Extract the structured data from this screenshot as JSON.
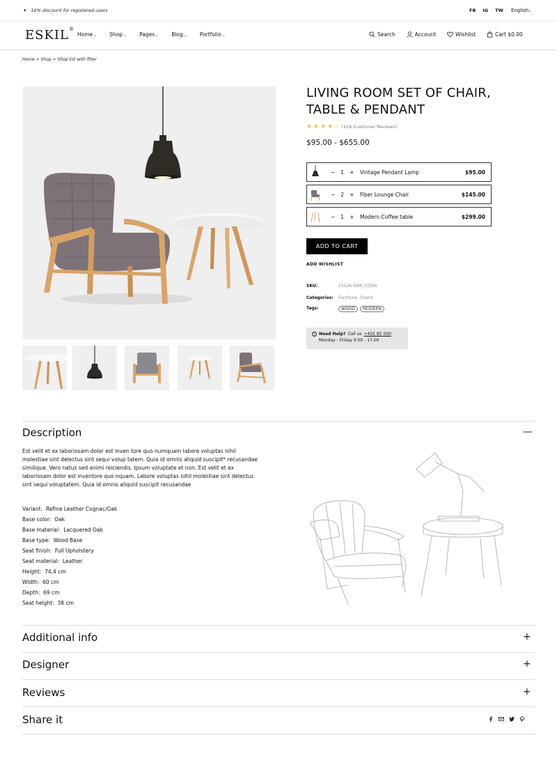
{
  "topbar": {
    "promo": "10% discount for registered users",
    "social": [
      "FB",
      "IG",
      "TW"
    ],
    "language": "English"
  },
  "header": {
    "logo": "ESKIL",
    "nav": [
      "Home",
      "Shop",
      "Pages",
      "Blog",
      "Portfolio"
    ],
    "search": "Search",
    "account": "Account",
    "wishlist": "Wishlist",
    "cart": "Cart $0.00"
  },
  "breadcrumb": "Home > Shop > Shop list with filter",
  "product": {
    "title_line1": "LIVING ROOM SET OF CHAIR,",
    "title_line2": "TABLE & PENDANT",
    "rating": 4,
    "reviews": "(126 Customer Reviews)",
    "price": "$95.00 - $655.00",
    "bundle": [
      {
        "qty": "1",
        "name": "Vintage Pendant Lamp",
        "price": "$95.00",
        "icon": "lamp-icon"
      },
      {
        "qty": "2",
        "name": "Fiber Lounge Chair",
        "price": "$145.00",
        "icon": "chair-icon"
      },
      {
        "qty": "1",
        "name": "Modern Coffee table",
        "price": "$299.00",
        "icon": "table-icon"
      }
    ],
    "minus": "−",
    "plus": "+",
    "add_to_cart": "ADD TO CART",
    "add_wishlist": "ADD WISHLIST",
    "sku_label": "SKU:",
    "sku": "25528-OAK_COGN",
    "categories_label": "Categories:",
    "categories": "Furniture, Chairs",
    "tags_label": "Tags:",
    "tags": [
      "WOOD",
      "MODERN"
    ],
    "help_label": "Need Help?",
    "help_call": "Call us",
    "help_phone": "+455 85 000",
    "help_hours": "Monday - Friday 9:00 - 17:00"
  },
  "description": {
    "heading": "Description",
    "text": "Est velit et ex laboriosam dolor est inven tore quo numquam labore voluptas nihil molestiae sint delectus sint sequi volup tatem. Quia id omnis aliquid suscipit* recusandae similique. Vero natus sed animi reiciendis. Ipsum voluptate et non. Est velit et ex laboriosam dolor est inventore quo nquam. Labore voluptas nihil molestiae sint delectus sint sequi voluptatem. Quia id omnis aliquid suscipit recusandae",
    "specs": [
      {
        "k": "Variant:",
        "v": "Refine Leather Cognac/Oak"
      },
      {
        "k": "Base color:",
        "v": "Oak"
      },
      {
        "k": "Base material:",
        "v": "Lacquered Oak"
      },
      {
        "k": "Base type:",
        "v": "Wood Base"
      },
      {
        "k": "Seat finish:",
        "v": "Full Upholstery"
      },
      {
        "k": "Seat material:",
        "v": "Leather"
      },
      {
        "k": "Height:",
        "v": "74,4 cm"
      },
      {
        "k": "Width:",
        "v": "60 cm"
      },
      {
        "k": "Depth:",
        "v": "69 cm"
      },
      {
        "k": "Seat height:",
        "v": "38 cm"
      }
    ]
  },
  "sections": {
    "additional": "Additional info",
    "designer": "Designer",
    "reviews": "Reviews",
    "share": "Share it",
    "expand": "+",
    "collapse": "—"
  },
  "colors": {
    "accent": "#000000",
    "star": "#f2b84b",
    "wood": "#d9a468",
    "fabric": "#7d7278"
  }
}
